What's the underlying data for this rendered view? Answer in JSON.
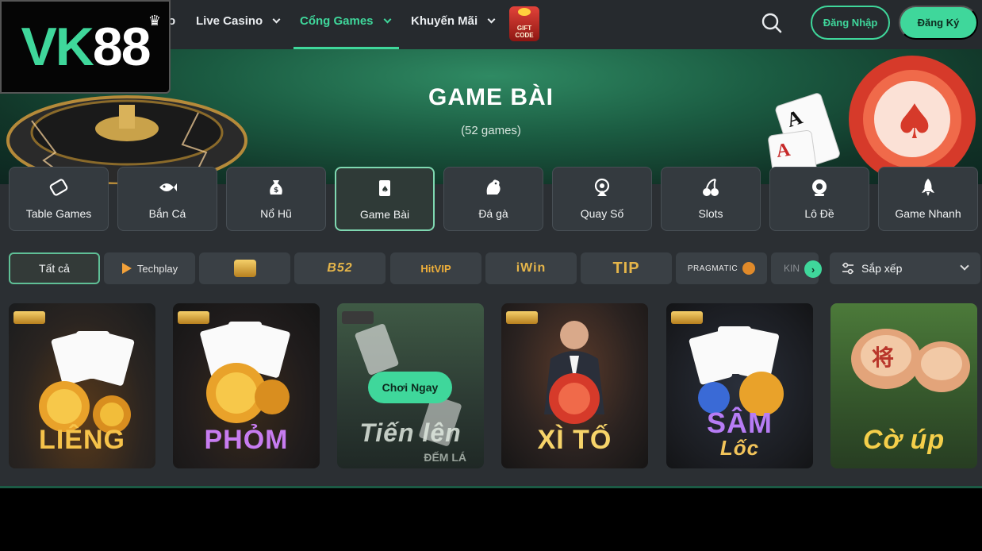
{
  "logo": {
    "part1": "VK",
    "part2": "88"
  },
  "nav": {
    "partial": "o",
    "items": [
      {
        "label": "Live Casino"
      },
      {
        "label": "Cổng Games"
      },
      {
        "label": "Khuyến Mãi"
      }
    ],
    "gift_code_line1": "GIFT",
    "gift_code_line2": "CODE"
  },
  "header": {
    "login_label": "Đăng Nhập",
    "register_label": "Đăng Ký"
  },
  "banner": {
    "title": "GAME BÀI",
    "count": "(52 games)"
  },
  "categories": [
    {
      "label": "Table Games",
      "icon": "table-games-icon"
    },
    {
      "label": "Bắn Cá",
      "icon": "fish-icon"
    },
    {
      "label": "Nổ Hũ",
      "icon": "money-bag-icon"
    },
    {
      "label": "Game Bài",
      "icon": "card-icon"
    },
    {
      "label": "Đá gà",
      "icon": "rooster-icon"
    },
    {
      "label": "Quay Số",
      "icon": "lottery-icon"
    },
    {
      "label": "Slots",
      "icon": "cherry-icon"
    },
    {
      "label": "Lô Đề",
      "icon": "ball-icon"
    },
    {
      "label": "Game Nhanh",
      "icon": "rocket-icon"
    }
  ],
  "providers": {
    "all": "Tất cả",
    "items": [
      "Techplay",
      "B52",
      "HitVIP",
      "iWin",
      "TIP",
      "PRAGMATIC",
      "KIN"
    ]
  },
  "sort": {
    "label": "Sắp xếp"
  },
  "games": [
    {
      "title": "LIÊNG"
    },
    {
      "title": "PHỎM"
    },
    {
      "title": "Tiến lên",
      "subtitle": "ĐẾM LÁ",
      "play_label": "Chơi Ngay"
    },
    {
      "title": "XÌ TỐ"
    },
    {
      "title": "SÂM",
      "subtitle": "Lốc"
    },
    {
      "title": "Cờ úp"
    }
  ],
  "colors": {
    "accent": "#3fd79b",
    "background": "#2b2f33",
    "gold": "#e5b54a"
  }
}
